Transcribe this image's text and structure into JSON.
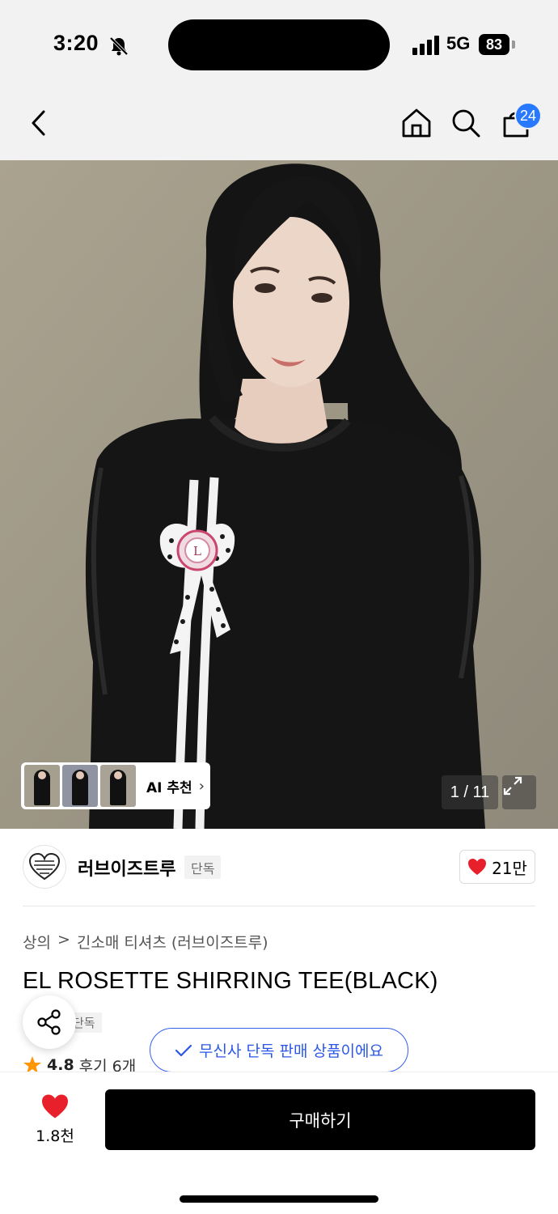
{
  "status_bar": {
    "time": "3:20",
    "network": "5G",
    "battery": "83",
    "icons": [
      "bell-muted-icon",
      "signal-icon",
      "battery-icon"
    ]
  },
  "nav": {
    "icons": [
      "back-icon",
      "home-icon",
      "search-icon",
      "cart-icon"
    ],
    "cart_count": "24"
  },
  "gallery": {
    "ai_label": "AI 추천",
    "page_indicator": "1 / 11",
    "thumbnails": 3
  },
  "brand": {
    "name": "러브이즈트루",
    "tag": "단독",
    "logo_text": "LOVEISTRUE",
    "like_count": "21만"
  },
  "product": {
    "breadcrumb": [
      "상의",
      ">",
      "긴소매 티셔츠 (러브이즈트루)"
    ],
    "title": "EL ROSETTE SHIRRING TEE(BLACK)",
    "exclusive_tag": "단독",
    "rating": "4.8",
    "reviews": "후기 6개",
    "exclusive_notice": "무신사 단독 판매 상품이에요"
  },
  "bottom_bar": {
    "wish_count": "1.8천",
    "buy_label": "구매하기"
  },
  "colors": {
    "accent_blue": "#2b57e8",
    "badge_blue": "#2979ff",
    "heart_red": "#e8202b",
    "star_orange": "#ff9500"
  }
}
